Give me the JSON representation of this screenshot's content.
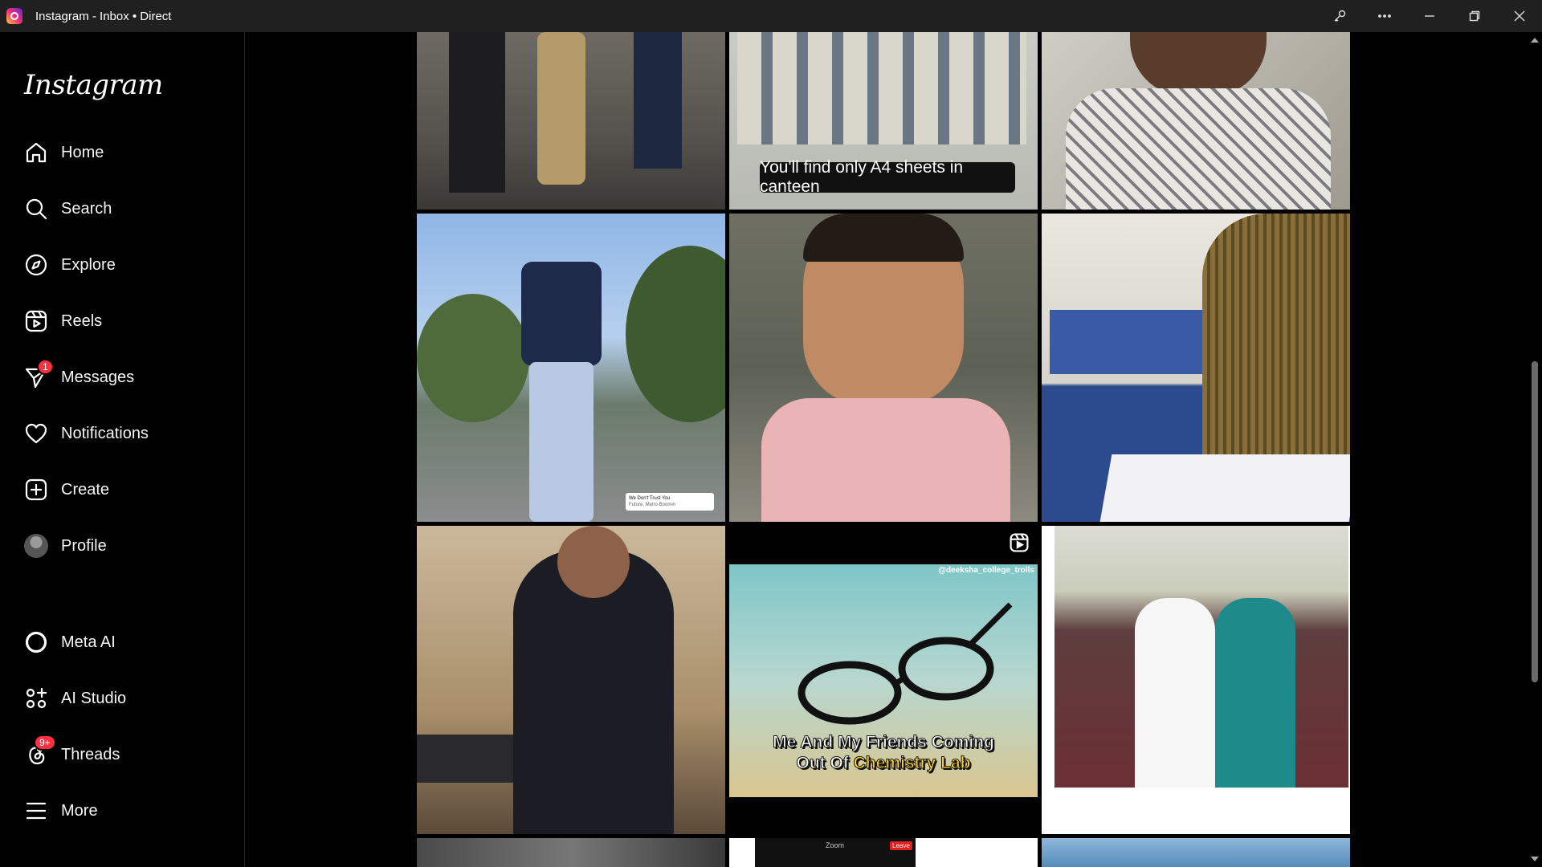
{
  "window": {
    "title": "Instagram - Inbox • Direct"
  },
  "sidebar": {
    "logo": "Instagram",
    "items": [
      {
        "label": "Home",
        "icon": "home-icon"
      },
      {
        "label": "Search",
        "icon": "search-icon"
      },
      {
        "label": "Explore",
        "icon": "compass-icon"
      },
      {
        "label": "Reels",
        "icon": "reels-icon"
      },
      {
        "label": "Messages",
        "icon": "messenger-icon",
        "badge": "1"
      },
      {
        "label": "Notifications",
        "icon": "heart-icon"
      },
      {
        "label": "Create",
        "icon": "plus-square-icon"
      },
      {
        "label": "Profile",
        "icon": "avatar"
      },
      {
        "label": "Meta AI",
        "icon": "meta-ai-ring-icon"
      },
      {
        "label": "AI Studio",
        "icon": "ai-studio-icon"
      },
      {
        "label": "Threads",
        "icon": "threads-icon",
        "badge": "9+"
      },
      {
        "label": "More",
        "icon": "hamburger-icon"
      }
    ]
  },
  "grid": {
    "tile_captions": {
      "canteen": "You'll find only A4 sheets in canteen",
      "reel_handle": "@deeksha_college_trolls",
      "reel_line1": "Me And My Friends Coming",
      "reel_line2_a": "Out Of ",
      "reel_line2_b": "Chemistry Lab",
      "music_tag_1": "We Don't Trust You",
      "music_tag_2": "Future, Metro Boomin",
      "zoom_label": "Zoom",
      "leave_label": "Leave"
    }
  },
  "colors": {
    "background": "#000000",
    "badge": "#ff3040",
    "reel_highlight": "#ffd21f"
  }
}
